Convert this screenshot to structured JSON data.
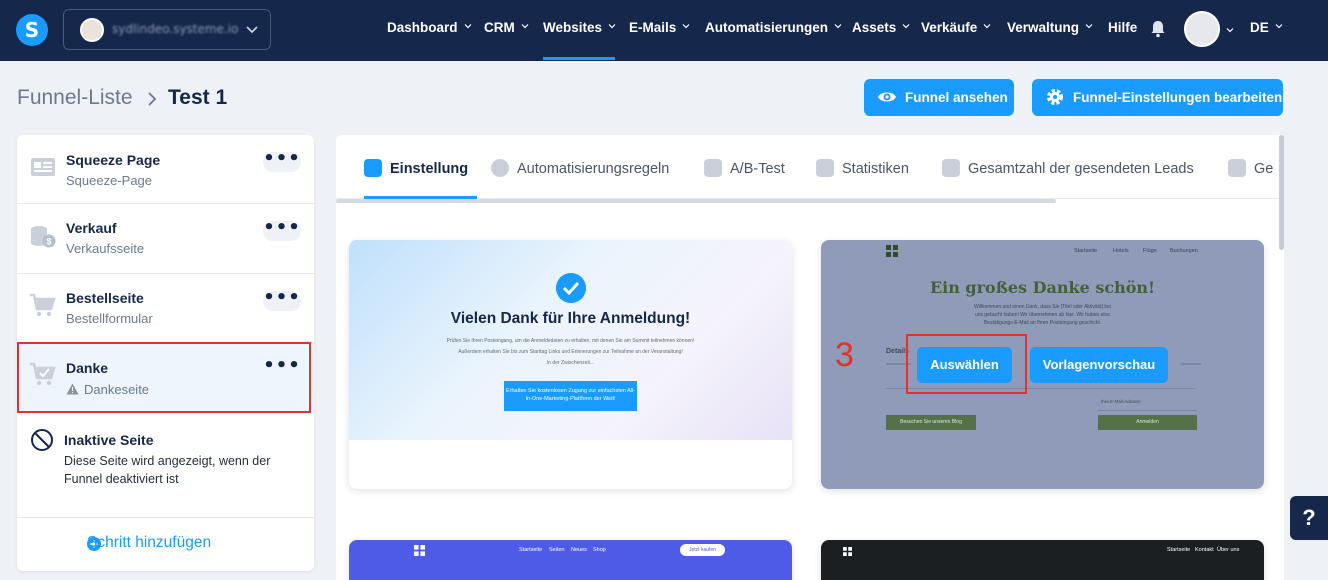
{
  "topbar": {
    "logo_letter": "S",
    "account_name": "sydlindeo.systeme.io",
    "nav": [
      {
        "label": "Dashboard",
        "caret": true
      },
      {
        "label": "CRM",
        "caret": true
      },
      {
        "label": "Websites",
        "caret": true,
        "active": true
      },
      {
        "label": "E-Mails",
        "caret": true
      },
      {
        "label": "Automatisierungen",
        "caret": true
      },
      {
        "label": "Assets",
        "caret": true
      },
      {
        "label": "Verkäufe",
        "caret": true
      },
      {
        "label": "Verwaltung",
        "caret": true
      },
      {
        "label": "Hilfe",
        "caret": false
      }
    ],
    "language": "DE"
  },
  "breadcrumb": {
    "parent": "Funnel-Liste",
    "current": "Test 1"
  },
  "header_buttons": {
    "view_funnel": "Funnel ansehen",
    "edit_settings": "Funnel-Einstellungen bearbeiten"
  },
  "steps": [
    {
      "title": "Squeeze Page",
      "subtitle": "Squeeze-Page",
      "icon": "form-icon"
    },
    {
      "title": "Verkauf",
      "subtitle": "Verkaufsseite",
      "icon": "coins-icon"
    },
    {
      "title": "Bestellseite",
      "subtitle": "Bestellformular",
      "icon": "cart-icon"
    },
    {
      "title": "Danke",
      "subtitle": "Dankeseite",
      "icon": "cart-check-icon",
      "warning": true,
      "active": true
    }
  ],
  "menu_dots": "•••",
  "inactive_page": {
    "title": "Inaktive Seite",
    "description": "Diese Seite wird angezeigt, wenn der Funnel deaktiviert ist"
  },
  "add_step_label": "Schritt hinzufügen",
  "tabs": [
    {
      "label": "Einstellung",
      "active": true
    },
    {
      "label": "Automatisierungsregeln"
    },
    {
      "label": "A/B-Test"
    },
    {
      "label": "Statistiken"
    },
    {
      "label": "Gesamtzahl der gesendeten Leads"
    },
    {
      "label": "Ge"
    }
  ],
  "template1": {
    "heading": "Vielen Dank für Ihre Anmeldung!",
    "line1": "Prüfen Sie Ihren Posteingang, um die Anmeldedaten zu erhalten, mit denen Sie am Summit teilnehmen können!",
    "line2": "Außerdem erhalten Sie bis zum Starttag Links und Erinnerungen zur Teilnahme an der Veranstaltung!",
    "line3": "In der Zwischenzeit...",
    "cta": "Erhalten Sie kostenlosen Zugang zur einfachsten All-In-One-Marketing-Plattform der Welt!"
  },
  "template2": {
    "nav": [
      "Startseite",
      "Hotels",
      "Flüge",
      "Buchungen"
    ],
    "heading": "Ein großes Danke schön!",
    "intro1": "Willkommen und einen Dank, dass Sie [Titel oder Aktivität] bei",
    "intro2": "uns gebucht haben! Wir übernehmen ab hier. Wir haben eine",
    "intro3": "Bestätigungs-E-Mail an Ihren Posteingang geschickt.",
    "annotation_number": "3",
    "select_button": "Auswählen",
    "preview_button": "Vorlagenvorschau",
    "details_label": "Details",
    "email_placeholder": "Ihre E-Mail-Adresse",
    "blog_button": "Besuchen Sie unseren Blog",
    "signup_button": "Anmelden"
  },
  "template3": {
    "nav": [
      "Startseite",
      "Seiten",
      "Neues",
      "Shop"
    ],
    "cta": "Jetzt kaufen"
  },
  "template4": {
    "nav": [
      "Startseite",
      "Kontakt",
      "Über uns"
    ]
  },
  "help_label": "?"
}
